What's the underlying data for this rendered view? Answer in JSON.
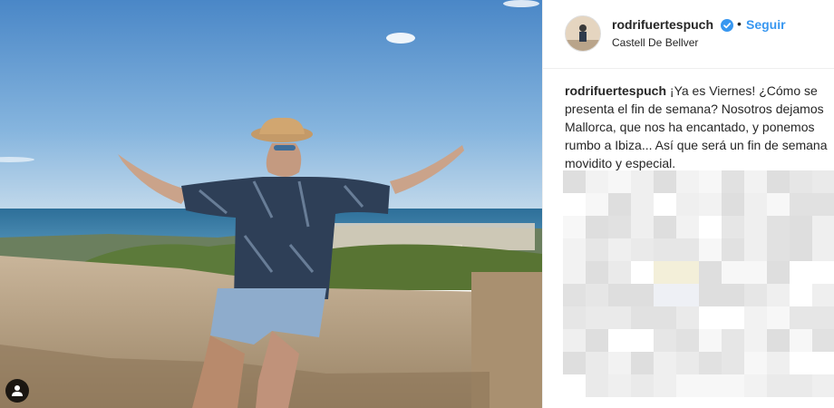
{
  "post": {
    "username": "rodrifuertespuch",
    "follow_label": "Seguir",
    "separator": "•",
    "location": "Castell De Bellver",
    "caption_username": "rodrifuertespuch",
    "caption_text": " ¡Ya es Viernes! ¿Cómo se presenta el fin de semana? Nosotros dejamos Mallorca, que nos ha encantado, y ponemos rumbo a Ibiza... Así que será un fin de semana movidito y especial."
  },
  "icons": {
    "verified": "verified-badge-icon",
    "tag": "person-tag-icon"
  },
  "colors": {
    "link_blue": "#3897f0",
    "verified_blue": "#3897f0",
    "text": "#262626",
    "divider": "#efefef"
  },
  "comments_blurred": true
}
